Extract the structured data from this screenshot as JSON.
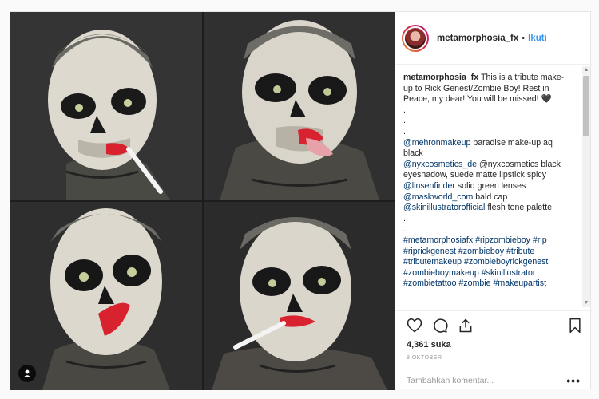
{
  "header": {
    "username": "metamorphosia_fx",
    "separator": "•",
    "follow_label": "Ikuti"
  },
  "caption": {
    "username": "metamorphosia_fx",
    "intro": "This is a tribute make-up to Rick Genest/Zombie Boy! Rest in Peace, my dear! You will be missed! 🖤",
    "intro_lines": [
      "This is a tribute make-",
      "up to Rick Genest/Zombie Boy! Rest in",
      "Peace, my dear! You will be missed! 🖤"
    ],
    "dots": [
      ".",
      ".",
      "."
    ],
    "credits": [
      {
        "tag": "@mehronmakeup",
        "text": " paradise make-up aq"
      },
      {
        "tag": "",
        "text": "black"
      },
      {
        "tag": "@nyxcosmetics_de",
        "text": " @nyxcosmetics black"
      },
      {
        "tag": "",
        "text": "eyeshadow, suede matte lipstick spicy"
      },
      {
        "tag": "@linsenfinder",
        "text": " solid green lenses"
      },
      {
        "tag": "@maskworld_com",
        "text": " bald cap"
      },
      {
        "tag": "@skinillustratorofficial",
        "text": " flesh tone palette"
      }
    ],
    "dots2": [
      ".",
      "."
    ],
    "hashtags": [
      "#metamorphosiafx #ripzombieboy #rip",
      "#riprickgenest #zombieboy #tribute",
      "#tributemakeup #zombieboyrickgenest",
      "#zombieboymakeup #skinillustrator",
      "#zombietattoo #zombie #makeupartist"
    ]
  },
  "actions": {
    "likes": "4,361 suka",
    "date": "8 OKTOBER",
    "comment_placeholder": "Tambahkan komentar...",
    "more_label": "•••"
  },
  "icons": [
    "heart-icon",
    "comment-icon",
    "share-icon",
    "bookmark-icon",
    "user-tag-icon"
  ],
  "colors": {
    "link": "#003569",
    "follow": "#3897f0",
    "lips": "#d8222f"
  }
}
